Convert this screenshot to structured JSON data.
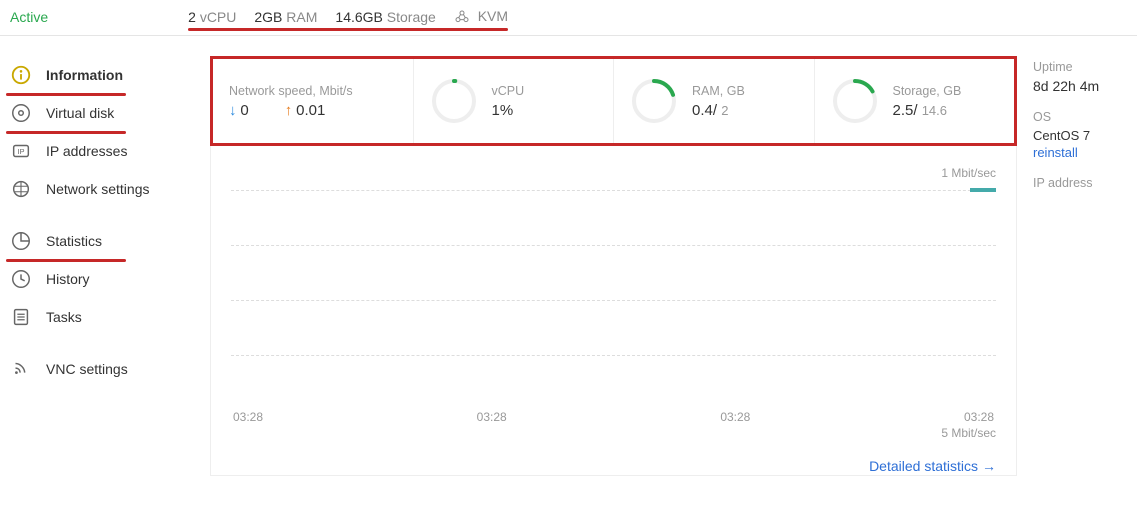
{
  "status": "Active",
  "specs": {
    "vcpu_n": "2",
    "vcpu_l": "vCPU",
    "ram_n": "2GB",
    "ram_l": "RAM",
    "storage_n": "14.6GB",
    "storage_l": "Storage",
    "virt": "KVM"
  },
  "sidebar": [
    {
      "label": "Information",
      "active": true,
      "underline": true
    },
    {
      "label": "Virtual disk",
      "underline": true
    },
    {
      "label": "IP addresses"
    },
    {
      "label": "Network settings"
    },
    {
      "label": "Statistics",
      "gap": true,
      "underline": true
    },
    {
      "label": "History"
    },
    {
      "label": "Tasks"
    },
    {
      "label": "VNC settings",
      "gap": true
    }
  ],
  "cards": {
    "net": {
      "label": "Network speed, Mbit/s",
      "down": "0",
      "up": "0.01"
    },
    "cpu": {
      "label": "vCPU",
      "value": "1%",
      "pct": 1
    },
    "ram": {
      "label": "RAM, GB",
      "used": "0.4",
      "total": "2",
      "pct": 20
    },
    "storage": {
      "label": "Storage, GB",
      "used": "2.5",
      "total": "14.6",
      "pct": 17
    }
  },
  "chart": {
    "top_scale": "1 Mbit/sec",
    "bot_scale": "5 Mbit/sec",
    "x_labels": [
      "03:28",
      "03:28",
      "03:28",
      "03:28"
    ],
    "details_link": "Detailed statistics"
  },
  "right": {
    "uptime_label": "Uptime",
    "uptime_value": "8d 22h 4m",
    "os_label": "OS",
    "os_value": "CentOS 7",
    "reinstall": "reinstall",
    "ip_label": "IP address"
  },
  "chart_data": {
    "type": "line",
    "title": "Network speed",
    "ylabel": "Mbit/sec",
    "ylim": [
      0,
      1
    ],
    "x": [
      "03:28",
      "03:28",
      "03:28",
      "03:28"
    ],
    "series": [
      {
        "name": "down",
        "values": [
          0,
          0,
          0,
          0
        ]
      },
      {
        "name": "up",
        "values": [
          0.01,
          0.01,
          0.01,
          0.01
        ]
      }
    ]
  }
}
